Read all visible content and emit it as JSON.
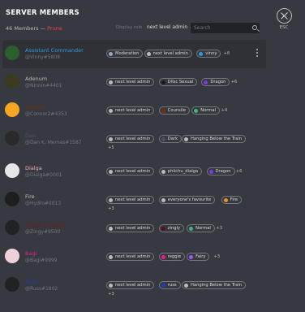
{
  "header": {
    "title": "SERVER MEMBERS",
    "member_count": "46 Members",
    "separator": "—",
    "prune_label": "Prune",
    "display_label": "Display role",
    "selected_role": "next level admin",
    "search_placeholder": "Search",
    "esc_label": "ESC"
  },
  "colors": {
    "moderation": "#99aab5",
    "next_level_admin": "#b9bbbe",
    "vinny": "#3498db",
    "dilsc_sexual": "#1a1a1a",
    "dragon": "#7c3aed",
    "counsiie": "#7a2e0a",
    "normal": "#43b581",
    "dark": "#4f545c",
    "hanging": "#b9bbbe",
    "philichu": "#b9bbbe",
    "everyones": "#b9bbbe",
    "fire": "#f28c28",
    "zingly": "#5c1111",
    "reggie": "#e91e8c",
    "fairy": "#a855f7",
    "russ": "#1f3fb5"
  },
  "members": [
    {
      "name": "Assistant Commander",
      "tag": "@Vinny#5808",
      "name_color": "#3498db",
      "roles": [
        "Moderation",
        "next level admin",
        "vinny"
      ],
      "role_colors": [
        "moderation",
        "next_level_admin",
        "vinny"
      ],
      "more": "+8"
    },
    {
      "name": "Adenum",
      "tag": "@Ninnin#4401",
      "name_color": "#b9bbbe",
      "roles": [
        "next level admin",
        "Dilsc Sexual",
        "Dragon"
      ],
      "role_colors": [
        "next_level_admin",
        "dilsc_sexual",
        "dragon"
      ],
      "more": "+6"
    },
    {
      "name": "Connor",
      "tag": "@Connor2#4353",
      "name_color": "#7a2e0a",
      "roles": [
        "next level admin",
        "Counsiie",
        "Normal"
      ],
      "role_colors": [
        "next_level_admin",
        "counsiie",
        "normal"
      ],
      "more": "+4"
    },
    {
      "name": "Dan",
      "tag": "@Dan K. Memes#1587",
      "name_color": "#4f545c",
      "roles": [
        "next level admin",
        "Dark",
        "Hanging Below the Train"
      ],
      "role_colors": [
        "next_level_admin",
        "dark",
        "hanging"
      ],
      "more": "+5"
    },
    {
      "name": "Dialga",
      "tag": "@Dialga#0001",
      "name_color": "#f5a7c8",
      "roles": [
        "next level admin",
        "phiichu_dialga",
        "Dragon"
      ],
      "role_colors": [
        "next_level_admin",
        "philichu",
        "dragon"
      ],
      "more": "+6"
    },
    {
      "name": "Fire",
      "tag": "@Hydro#0013",
      "name_color": "#b9bbbe",
      "roles": [
        "next level admin",
        "everyone's favourite",
        "Fire"
      ],
      "role_colors": [
        "next_level_admin",
        "everyones",
        "fire"
      ],
      "more": "+3"
    },
    {
      "name": "Zingly Zinglezz",
      "tag": "@Zingy#9500",
      "name_color": "#7a1a1a",
      "roles": [
        "next level admin",
        "zingly",
        "Normal"
      ],
      "role_colors": [
        "next_level_admin",
        "zingly",
        "normal"
      ],
      "more": "+3"
    },
    {
      "name": "Bagi",
      "tag": "@Bagi#9999",
      "name_color": "#e91e8c",
      "roles": [
        "next level admin",
        "reggie",
        "Fairy"
      ],
      "role_colors": [
        "next_level_admin",
        "reggie",
        "fairy"
      ],
      "more": "+3"
    },
    {
      "name": "Russ",
      "tag": "@Russ#1802",
      "name_color": "#1f3fb5",
      "roles": [
        "next level admin",
        "russ",
        "Hanging Below the Train"
      ],
      "role_colors": [
        "next_level_admin",
        "russ",
        "hanging"
      ],
      "more": "+3"
    }
  ]
}
